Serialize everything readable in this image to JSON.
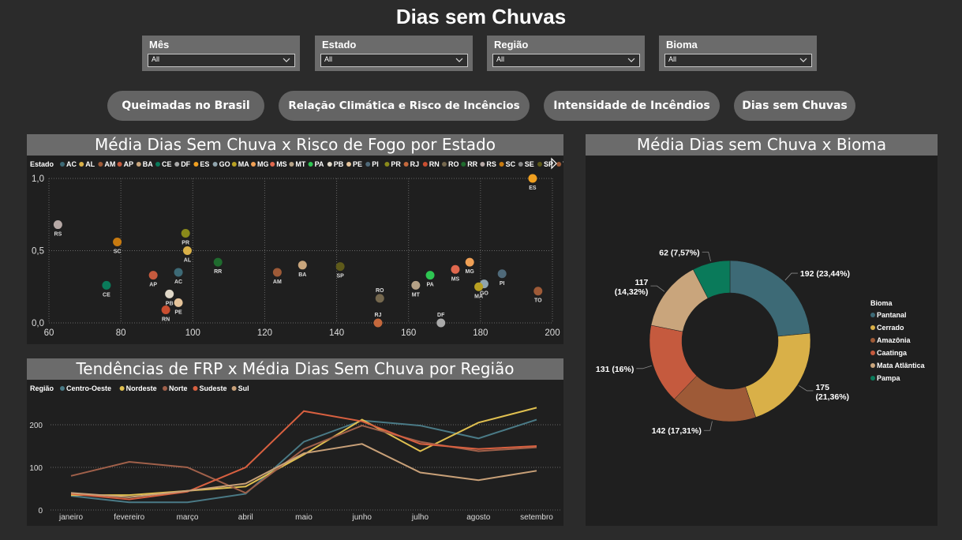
{
  "title": "Dias sem Chuvas",
  "filters": [
    {
      "label": "Mês",
      "value": "All"
    },
    {
      "label": "Estado",
      "value": "All"
    },
    {
      "label": "Região",
      "value": "All"
    },
    {
      "label": "Bioma",
      "value": "All"
    }
  ],
  "nav": {
    "btn1": "Queimadas no Brasil",
    "btn2": "Relação Climática e Risco de Incêncios",
    "btn3": "Intensidade de Incêndios",
    "btn4": "Dias sem Chuvas"
  },
  "scatter_title": "Média Dias Sem Chuva x Risco de Fogo por Estado",
  "donut_title": "Média Dias sem Chuva x Bioma",
  "line_title": "Tendências de FRP x Média Dias Sem Chuva por Região",
  "colors": {
    "background": "#2b2b2b",
    "panel": "#1f1f1f",
    "header": "#6b6b6b"
  },
  "chart_data": [
    {
      "type": "scatter",
      "title": "Média Dias Sem Chuva x Risco de Fogo por Estado",
      "legend_title": "Estado",
      "xlim": [
        60,
        200
      ],
      "ylim": [
        0,
        1
      ],
      "xticks": [
        "60",
        "80",
        "100",
        "120",
        "140",
        "160",
        "180",
        "200"
      ],
      "yticks": [
        "0,0",
        "0,5",
        "1,0"
      ],
      "grid": true,
      "points": [
        {
          "name": "AC",
          "x": 96,
          "y": 0.35,
          "color": "#3d6a76"
        },
        {
          "name": "AL",
          "x": 98.5,
          "y": 0.5,
          "color": "#d9b048"
        },
        {
          "name": "AM",
          "x": 123.5,
          "y": 0.35,
          "color": "#9e5a37"
        },
        {
          "name": "AP",
          "x": 89,
          "y": 0.33,
          "color": "#c55a3e"
        },
        {
          "name": "BA",
          "x": 130.5,
          "y": 0.4,
          "color": "#c9a57c"
        },
        {
          "name": "CE",
          "x": 76,
          "y": 0.26,
          "color": "#0a7a5a"
        },
        {
          "name": "DF",
          "x": 169,
          "y": 0.0,
          "color": "#aaaaaa"
        },
        {
          "name": "ES",
          "x": 194.5,
          "y": 1.0,
          "color": "#f0a020"
        },
        {
          "name": "GO",
          "x": 181,
          "y": 0.27,
          "color": "#8fa4ad"
        },
        {
          "name": "MA",
          "x": 179.5,
          "y": 0.25,
          "color": "#b8a022"
        },
        {
          "name": "MG",
          "x": 177,
          "y": 0.42,
          "color": "#f0a055"
        },
        {
          "name": "MS",
          "x": 173,
          "y": 0.37,
          "color": "#e0684e"
        },
        {
          "name": "MT",
          "x": 162,
          "y": 0.26,
          "color": "#b5a186"
        },
        {
          "name": "PA",
          "x": 166,
          "y": 0.33,
          "color": "#2ec652"
        },
        {
          "name": "PB",
          "x": 93.5,
          "y": 0.2,
          "color": "#e0d8c8"
        },
        {
          "name": "PE",
          "x": 96,
          "y": 0.14,
          "color": "#e6c49a"
        },
        {
          "name": "PI",
          "x": 186,
          "y": 0.34,
          "color": "#4f6a7a"
        },
        {
          "name": "PR",
          "x": 98,
          "y": 0.62,
          "color": "#8a8a1a"
        },
        {
          "name": "RJ",
          "x": 151.5,
          "y": 0.0,
          "color": "#c4683c"
        },
        {
          "name": "RN",
          "x": 92.5,
          "y": 0.09,
          "color": "#c94e30"
        },
        {
          "name": "RO",
          "x": 152,
          "y": 0.17,
          "color": "#75684e"
        },
        {
          "name": "RR",
          "x": 107,
          "y": 0.42,
          "color": "#1f6b2e"
        },
        {
          "name": "RS",
          "x": 62.5,
          "y": 0.68,
          "color": "#b5a8a5"
        },
        {
          "name": "SC",
          "x": 79,
          "y": 0.56,
          "color": "#c77a10"
        },
        {
          "name": "SE",
          "x": 0,
          "y": 0,
          "color": "#8a8a8a",
          "hidden": true
        },
        {
          "name": "SP",
          "x": 141,
          "y": 0.39,
          "color": "#5e5a1a"
        },
        {
          "name": "TO",
          "x": 196,
          "y": 0.22,
          "color": "#9e5a37"
        }
      ]
    },
    {
      "type": "pie",
      "title": "Média Dias sem Chuva x Bioma",
      "legend_title": "Bioma",
      "legend_position": "right",
      "slices": [
        {
          "name": "Pantanal",
          "value": 192,
          "label": "192 (23,44%)",
          "color": "#3d6a76"
        },
        {
          "name": "Cerrado",
          "value": 175,
          "label": "175 (21,36%)",
          "color": "#d9b048"
        },
        {
          "name": "Amazônia",
          "value": 142,
          "label": "142 (17,31%)",
          "color": "#9e5a37"
        },
        {
          "name": "Caatinga",
          "value": 131,
          "label": "131 (16%)",
          "color": "#c55a3e"
        },
        {
          "name": "Mata Atlântica",
          "value": 117,
          "label": "117 (14,32%)",
          "color": "#c9a57c"
        },
        {
          "name": "Pampa",
          "value": 62,
          "label": "62 (7,57%)",
          "color": "#0a7a5a"
        }
      ]
    },
    {
      "type": "line",
      "title": "Tendências de FRP x Média Dias Sem Chuva por Região",
      "legend_title": "Região",
      "categories": [
        "janeiro",
        "fevereiro",
        "março",
        "abril",
        "maio",
        "junho",
        "julho",
        "agosto",
        "setembro"
      ],
      "ylim": [
        0,
        250
      ],
      "yticks": [
        "0",
        "100",
        "200"
      ],
      "grid": true,
      "series": [
        {
          "name": "Centro-Oeste",
          "color": "#4a7a86",
          "values": [
            33,
            18,
            18,
            38,
            160,
            210,
            198,
            168,
            212
          ]
        },
        {
          "name": "Nordeste",
          "color": "#e0c050",
          "values": [
            35,
            35,
            45,
            55,
            130,
            212,
            138,
            205,
            240
          ]
        },
        {
          "name": "Norte",
          "color": "#a0604a",
          "values": [
            80,
            113,
            100,
            40,
            143,
            198,
            160,
            138,
            147
          ]
        },
        {
          "name": "Sudeste",
          "color": "#d86040",
          "values": [
            38,
            25,
            43,
            100,
            232,
            208,
            155,
            143,
            150
          ]
        },
        {
          "name": "Sul",
          "color": "#c8a078",
          "values": [
            40,
            30,
            45,
            62,
            133,
            155,
            88,
            70,
            92
          ]
        }
      ]
    }
  ]
}
